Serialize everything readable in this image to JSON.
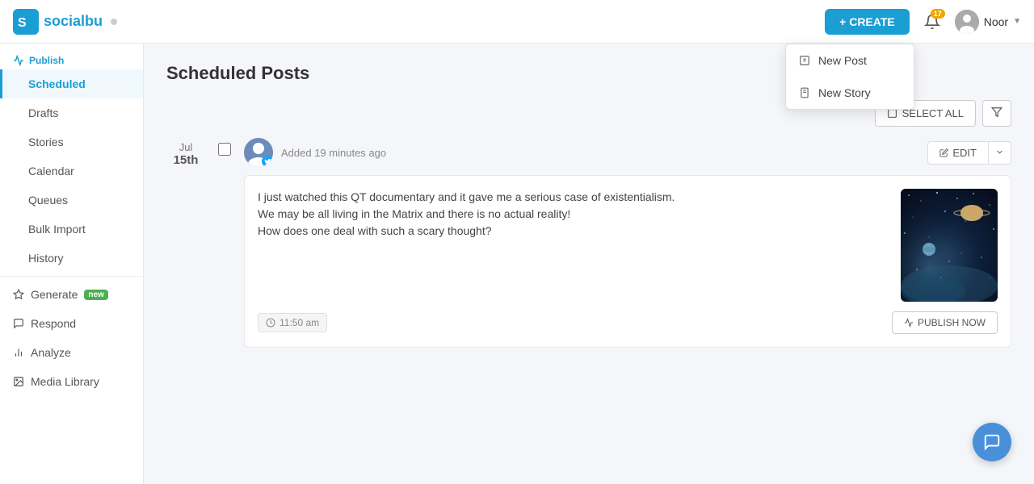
{
  "header": {
    "logo_text": "socialbu",
    "status_label": "online",
    "create_btn": "+ CREATE",
    "notif_count": "17",
    "user_name": "Noor"
  },
  "sidebar": {
    "publish_label": "Publish",
    "items": [
      {
        "id": "scheduled",
        "label": "Scheduled",
        "active": true
      },
      {
        "id": "drafts",
        "label": "Drafts",
        "active": false
      },
      {
        "id": "stories",
        "label": "Stories",
        "active": false
      },
      {
        "id": "calendar",
        "label": "Calendar",
        "active": false
      },
      {
        "id": "queues",
        "label": "Queues",
        "active": false
      },
      {
        "id": "bulk-import",
        "label": "Bulk Import",
        "active": false
      },
      {
        "id": "history",
        "label": "History",
        "active": false
      }
    ],
    "generate_label": "Generate",
    "generate_badge": "new",
    "respond_label": "Respond",
    "analyze_label": "Analyze",
    "media_library_label": "Media Library"
  },
  "page": {
    "title": "Scheduled Posts",
    "select_all_label": "SELECT ALL",
    "filter_label": ""
  },
  "post": {
    "date_month": "Jul",
    "date_day": "15th",
    "added_label": "Added 19 minutes ago",
    "text_line1": "I just watched this QT documentary and it gave me a serious case of existentialism.",
    "text_line2": "We may be all living in the Matrix and there is no actual reality!",
    "text_line3": "How does one deal with such a scary thought?",
    "time_label": "11:50 am",
    "edit_label": "EDIT",
    "publish_now_label": "PUBLISH NOW"
  },
  "dropdown": {
    "items": [
      {
        "id": "new-post",
        "label": "New Post",
        "icon": "file-icon"
      },
      {
        "id": "new-story",
        "label": "New Story",
        "icon": "story-icon"
      }
    ]
  },
  "colors": {
    "brand": "#1a9ed4",
    "active_sidebar": "#1a9ed4",
    "generate_badge": "#4caf50",
    "notif_badge": "#f0a500",
    "fab": "#4a90d9"
  }
}
